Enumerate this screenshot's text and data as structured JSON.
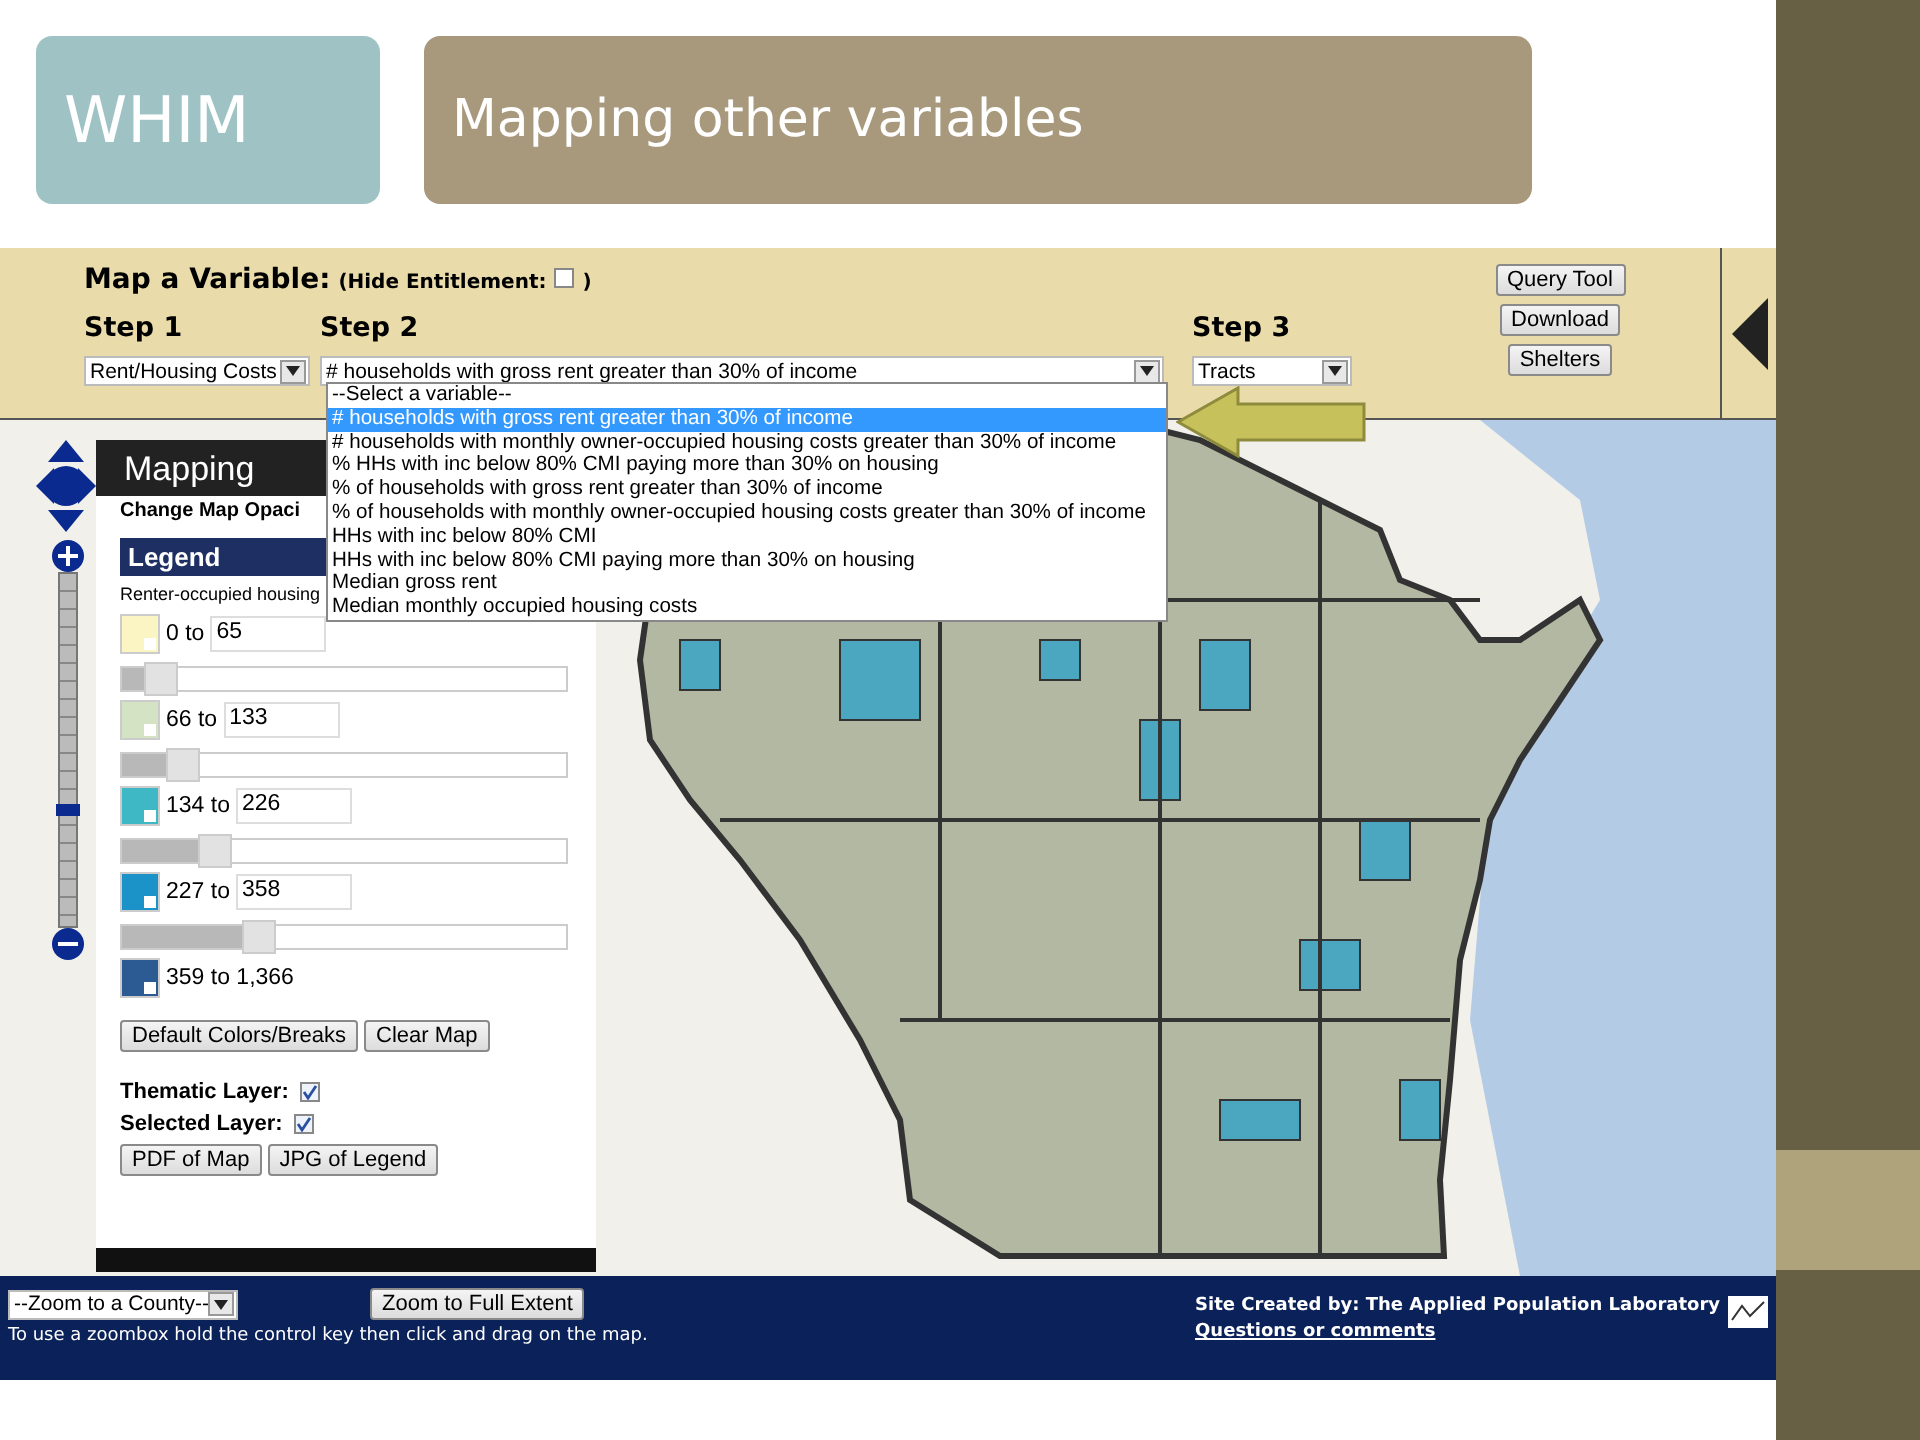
{
  "slide": {
    "badge": "WHIM",
    "title": "Mapping other variables"
  },
  "header": {
    "heading": "Map a Variable:",
    "hide_entitlement": {
      "label": "(Hide Entitlement:",
      "close": ")",
      "checked": false
    },
    "steps": [
      {
        "label": "Step 1",
        "value": "Rent/Housing Costs"
      },
      {
        "label": "Step 2",
        "value": "# households with gross rent greater than 30% of income"
      },
      {
        "label": "Step 3",
        "value": "Tracts"
      }
    ],
    "dropdown_options": [
      {
        "label": "--Select a variable--",
        "selected": false
      },
      {
        "label": "# households with gross rent greater than 30% of income",
        "selected": true
      },
      {
        "label": "# households with monthly owner-occupied housing costs greater than 30% of income",
        "selected": false
      },
      {
        "label": "% HHs with inc below 80% CMI paying more than 30% on housing",
        "selected": false
      },
      {
        "label": "% of households with gross rent greater than 30% of income",
        "selected": false
      },
      {
        "label": "% of households with monthly owner-occupied housing costs greater than 30% of income",
        "selected": false
      },
      {
        "label": "HHs with inc below 80% CMI",
        "selected": false
      },
      {
        "label": "HHs with inc below 80% CMI paying more than 30% on housing",
        "selected": false
      },
      {
        "label": "Median gross rent",
        "selected": false
      },
      {
        "label": "Median monthly occupied housing costs",
        "selected": false
      }
    ],
    "buttons": [
      "Query Tool",
      "Download",
      "Shelters"
    ]
  },
  "zoom": {
    "level": 0.33
  },
  "panel": {
    "title": "Mapping",
    "subtitle": "Change Map Opaci",
    "legend_title": "Legend",
    "variable": "Renter-occupied housing",
    "classes": [
      {
        "range": "0 to",
        "upper": "65",
        "color": "#fbf5c3",
        "level": 0.05
      },
      {
        "range": "66 to",
        "upper": "133",
        "color": "#d4e3c3",
        "level": 0.1
      },
      {
        "range": "134 to",
        "upper": "226",
        "color": "#3fb8c5",
        "level": 0.17
      },
      {
        "range": "227 to",
        "upper": "358",
        "color": "#1b93c9",
        "level": 0.27
      },
      {
        "range": "359 to 1,366",
        "color": "#2c5b94"
      }
    ],
    "buttons": [
      "Default Colors/Breaks",
      "Clear Map"
    ],
    "layers": [
      {
        "label": "Thematic Layer:",
        "checked": true
      },
      {
        "label": "Selected Layer:",
        "checked": true
      }
    ],
    "exports": [
      "PDF of Map",
      "JPG of Legend"
    ]
  },
  "footer": {
    "county_select": "--Zoom to a County--",
    "zoom_button": "Zoom to Full Extent",
    "hint": "To use a zoombox hold the control key then click and drag on the map.",
    "credit": "Site Created by: The Applied Population Laboratory",
    "link": "Questions or comments"
  }
}
